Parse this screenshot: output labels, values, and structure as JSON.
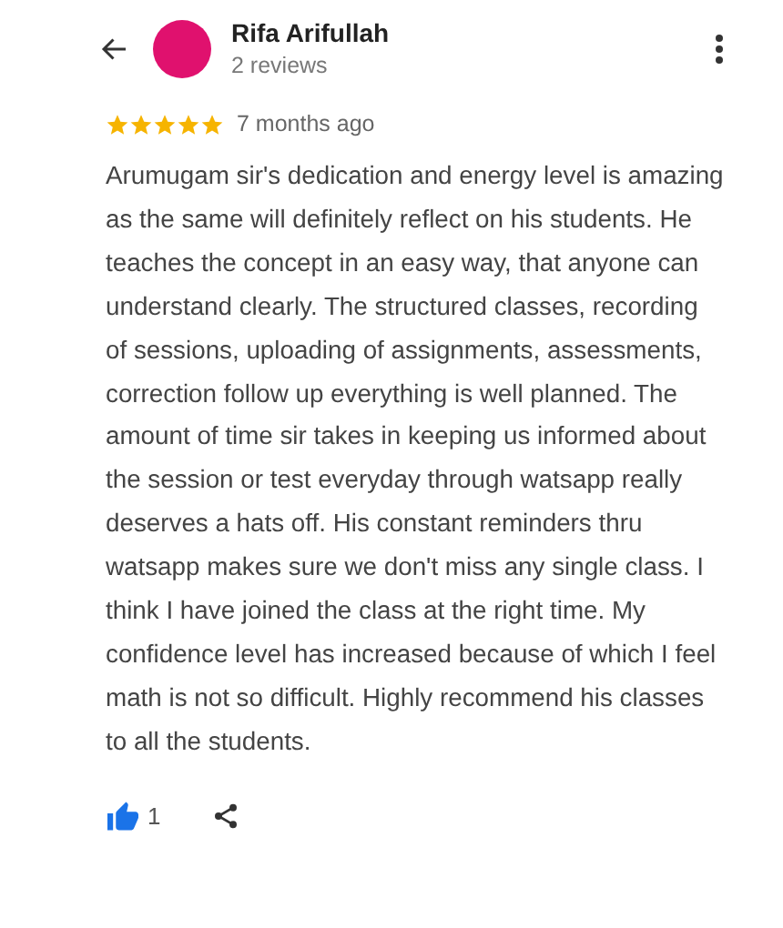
{
  "reviewer": {
    "name": "Rifa Arifullah",
    "reviews": "2 reviews"
  },
  "rating": {
    "stars": 5,
    "time": "7 months ago"
  },
  "review_text": "Arumugam sir's dedication and energy level is amazing as the same will definitely reflect on his students. He teaches the concept in an easy way, that anyone can understand clearly. The structured classes, recording of sessions, uploading of assignments, assessments, correction follow up everything is well planned. The amount of time sir takes in keeping us informed about the session or test everyday through watsapp really deserves a hats off. His constant reminders thru watsapp makes sure we don't miss any single class. I think I have joined the class at the right time. My confidence level has increased because of which I feel math is not so difficult. Highly recommend his classes to all the students.",
  "like": {
    "liked": true,
    "count": "1"
  }
}
